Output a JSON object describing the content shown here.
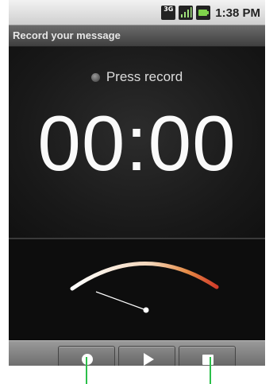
{
  "status_bar": {
    "network_label": "3G",
    "time": "1:38 PM",
    "icons": [
      "network-3g-icon",
      "signal-strength-icon",
      "battery-icon"
    ]
  },
  "title_bar": {
    "title": "Record your message"
  },
  "recorder": {
    "state_text": "Press record",
    "timer": "00:00"
  },
  "vu_meter": {
    "level": 0.1,
    "colors": {
      "start": "#ffffff",
      "end": "#d23c2a",
      "needle": "#ffffff"
    }
  },
  "controls": {
    "buttons": [
      {
        "name": "record",
        "icon": "record-icon"
      },
      {
        "name": "play",
        "icon": "play-icon"
      },
      {
        "name": "stop",
        "icon": "stop-icon"
      }
    ]
  },
  "colors": {
    "title_bar_bg": "#4f4f4f",
    "screen_bg": "#1a1a1a",
    "annotation": "#2bbf4a"
  }
}
